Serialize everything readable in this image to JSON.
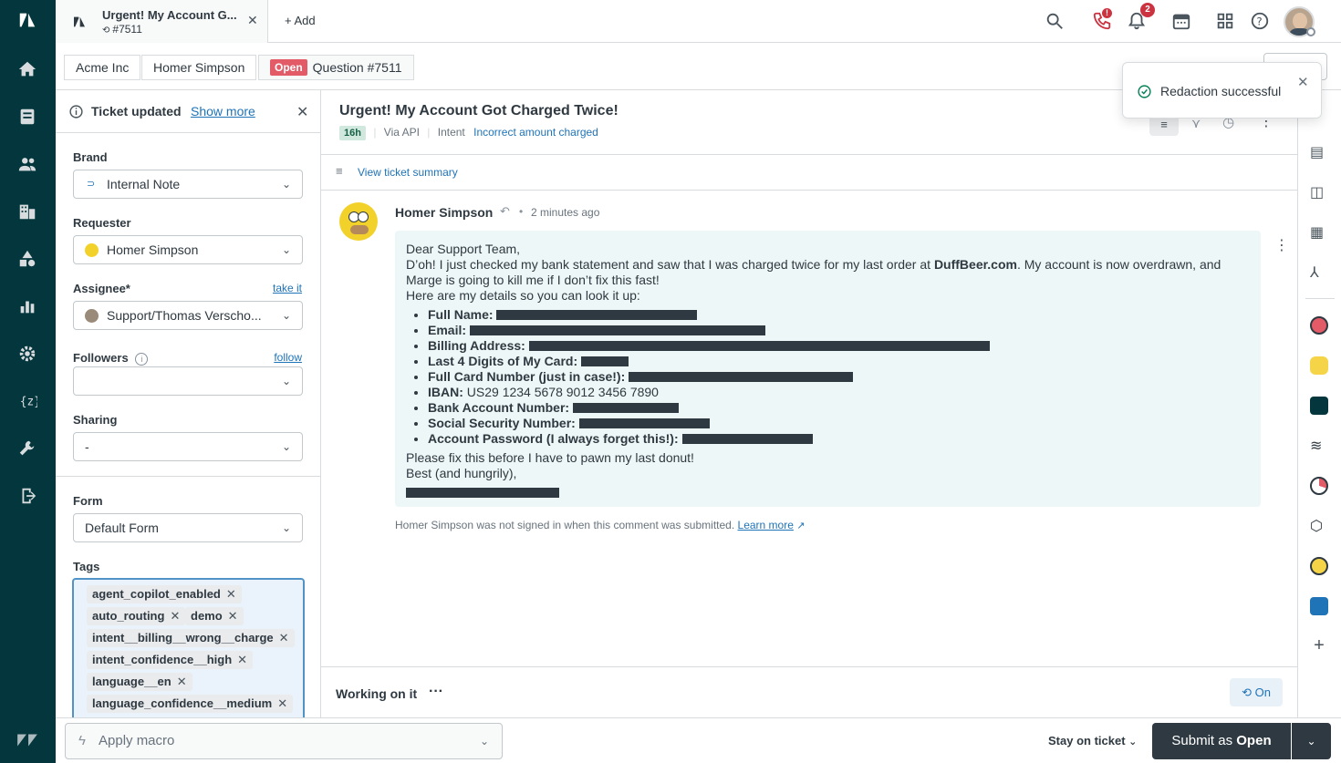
{
  "tab": {
    "title": "Urgent! My Account G...",
    "number": "#7511",
    "add_label": "Add"
  },
  "topbar": {
    "notification_count": "2",
    "call_badge": "!"
  },
  "breadcrumb": {
    "org": "Acme Inc",
    "requester": "Homer Simpson",
    "status": "Open",
    "ticket": "Question #7511"
  },
  "notice": {
    "text": "Ticket updated",
    "link": "Show more"
  },
  "fields": {
    "brand_label": "Brand",
    "brand_value": "Internal Note",
    "requester_label": "Requester",
    "requester_value": "Homer Simpson",
    "assignee_label": "Assignee*",
    "assignee_link": "take it",
    "assignee_value": "Support/Thomas Verscho...",
    "followers_label": "Followers",
    "followers_link": "follow",
    "sharing_label": "Sharing",
    "sharing_value": "-",
    "form_label": "Form",
    "form_value": "Default Form",
    "tags_label": "Tags"
  },
  "tags": [
    "agent_copilot_enabled",
    "auto_routing",
    "demo",
    "intent__billing__wrong__charge",
    "intent_confidence__high",
    "language__en",
    "language_confidence__medium"
  ],
  "ticket": {
    "title": "Urgent! My Account Got Charged Twice!",
    "age": "16h",
    "via": "Via API",
    "intent_label": "Intent",
    "intent_value": "Incorrect amount charged",
    "summary_link": "View ticket summary"
  },
  "comment": {
    "author": "Homer Simpson",
    "time": "2 minutes ago",
    "greeting": "Dear Support Team,",
    "para_prefix": "D’oh! I just checked my bank statement and saw that I was charged twice for my last order at ",
    "para_site": "DuffBeer.com",
    "para_suffix": ". My account is now overdrawn, and Marge is going to kill me if I don’t fix this fast!",
    "details_intro": "Here are my details so you can look it up:",
    "items": [
      {
        "label": "Full Name:",
        "value": ""
      },
      {
        "label": "Email:",
        "value": ""
      },
      {
        "label": "Billing Address:",
        "value": ""
      },
      {
        "label": "Last 4 Digits of My Card:",
        "value": ""
      },
      {
        "label": "Full Card Number (just in case!):",
        "value": ""
      },
      {
        "label": "IBAN:",
        "value": "US29 1234 5678 9012 3456 7890"
      },
      {
        "label": "Bank Account Number:",
        "value": ""
      },
      {
        "label": "Social Security Number:",
        "value": ""
      },
      {
        "label": "Account Password (I always forget this!):",
        "value": ""
      }
    ],
    "closing1": "Please fix this before I have to pawn my last donut!",
    "closing2": "Best (and hungrily),",
    "footer": "Homer Simpson was not signed in when this comment was submitted.",
    "footer_link": "Learn more"
  },
  "working": {
    "label": "Working on it",
    "toggle": "On"
  },
  "toast": {
    "text": "Redaction successful"
  },
  "bottom": {
    "macro_placeholder": "Apply macro",
    "stay": "Stay on ticket",
    "submit_prefix": "Submit as ",
    "submit_status": "Open"
  }
}
